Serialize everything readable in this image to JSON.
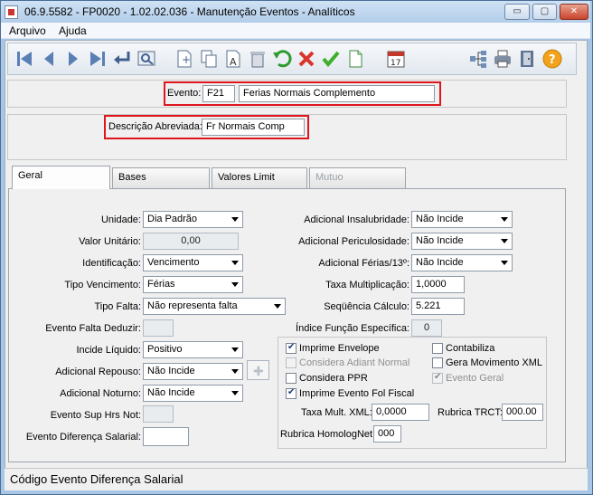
{
  "window": {
    "title": "06.9.5582 - FP0020 - 1.02.02.036 - Manutenção Eventos - Analíticos",
    "buttons": {
      "minimize": "▭",
      "maximize": "▢",
      "close": "✕"
    }
  },
  "menu": {
    "items": [
      "Arquivo",
      "Ajuda"
    ]
  },
  "toolbar": {
    "icons": [
      "first-icon",
      "prev-icon",
      "next-icon",
      "last-icon",
      "enter-icon",
      "search-icon",
      "new-icon",
      "copy-icon",
      "edit-icon",
      "delete-icon",
      "undo-icon",
      "cancel-icon",
      "confirm-icon",
      "note-icon",
      "calendar-icon",
      "tree-icon",
      "print-icon",
      "exit-icon",
      "help-icon"
    ],
    "calendar_day": "17",
    "help_symbol": "?"
  },
  "header": {
    "evento_label": "Evento:",
    "evento_code": "F21",
    "evento_name": "Ferias Normais Complemento",
    "descricao_label": "Descrição Abreviada:",
    "descricao_value": "Fr Normais Comp"
  },
  "tabs": [
    {
      "label": "Geral",
      "state": "active"
    },
    {
      "label": "Bases",
      "state": "normal"
    },
    {
      "label": "Valores Limit",
      "state": "normal"
    },
    {
      "label": "Mutuo",
      "state": "disabled"
    }
  ],
  "left_fields": {
    "unidade": {
      "label": "Unidade:",
      "value": "Dia Padrão"
    },
    "valor_unitario": {
      "label": "Valor Unitário:",
      "value": "0,00"
    },
    "identificacao": {
      "label": "Identificação:",
      "value": "Vencimento"
    },
    "tipo_vencimento": {
      "label": "Tipo Vencimento:",
      "value": "Férias"
    },
    "tipo_falta": {
      "label": "Tipo Falta:",
      "value": "Não representa falta"
    },
    "evento_falta_deduzir": {
      "label": "Evento Falta Deduzir:",
      "value": ""
    },
    "incide_liquido": {
      "label": "Incide Líquido:",
      "value": "Positivo"
    },
    "adicional_repouso": {
      "label": "Adicional Repouso:",
      "value": "Não Incide"
    },
    "adicional_noturno": {
      "label": "Adicional Noturno:",
      "value": "Não Incide"
    },
    "evento_sup_hrs_not": {
      "label": "Evento Sup Hrs Not:",
      "value": ""
    },
    "evento_diferenca_salarial": {
      "label": "Evento Diferença Salarial:",
      "value": ""
    }
  },
  "right_fields": {
    "adicional_insalubridade": {
      "label": "Adicional Insalubridade:",
      "value": "Não Incide"
    },
    "adicional_periculosidade": {
      "label": "Adicional Periculosidade:",
      "value": "Não Incide"
    },
    "adicional_ferias": {
      "label": "Adicional Férias/13º:",
      "value": "Não Incide"
    },
    "taxa_multiplicacao": {
      "label": "Taxa Multiplicação:",
      "value": "1,0000"
    },
    "sequencia_calculo": {
      "label": "Seqüência Cálculo:",
      "value": "5.221"
    },
    "indice_funcao_especifica": {
      "label": "Índice Função Específica:",
      "value": "0"
    }
  },
  "checkboxes": [
    {
      "label": "Imprime Envelope",
      "checked": true,
      "enabled": true
    },
    {
      "label": "Contabiliza",
      "checked": false,
      "enabled": true
    },
    {
      "label": "Considera Adiant Normal",
      "checked": false,
      "enabled": false
    },
    {
      "label": "Gera Movimento XML",
      "checked": false,
      "enabled": true
    },
    {
      "label": "Considera PPR",
      "checked": false,
      "enabled": true
    },
    {
      "label": "Evento Geral",
      "checked": true,
      "enabled": false
    },
    {
      "label": "Imprime Evento Fol Fiscal",
      "checked": true,
      "enabled": true
    }
  ],
  "box_fields": {
    "taxa_mult_xml": {
      "label": "Taxa Mult. XML:",
      "value": "0,0000"
    },
    "rubrica_trct": {
      "label": "Rubrica TRCT:",
      "value": "000.00"
    },
    "rubrica_homolognet": {
      "label": "Rubrica HomologNet:",
      "value": "000"
    }
  },
  "status": {
    "text": "Código Evento Diferença Salarial"
  }
}
